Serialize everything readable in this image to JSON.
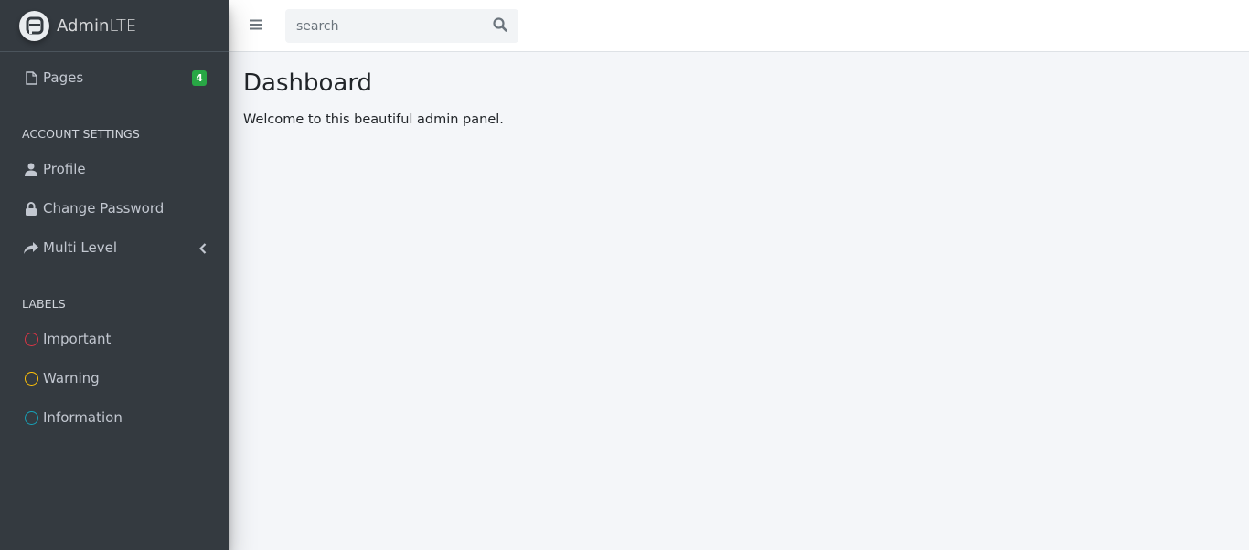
{
  "brand": {
    "name_bold": "Admin",
    "name_light": "LTE"
  },
  "sidebar": {
    "pages": {
      "label": "Pages",
      "badge": "4",
      "icon": "file-icon"
    },
    "account_header": "ACCOUNT SETTINGS",
    "account_items": [
      {
        "label": "Profile",
        "icon": "user-icon"
      },
      {
        "label": "Change Password",
        "icon": "lock-icon"
      },
      {
        "label": "Multi Level",
        "icon": "share-icon"
      }
    ],
    "labels_header": "LABELS",
    "label_items": [
      {
        "label": "Important",
        "color": "#dc3545"
      },
      {
        "label": "Warning",
        "color": "#ffc107"
      },
      {
        "label": "Information",
        "color": "#17a2b8"
      }
    ]
  },
  "topbar": {
    "search_placeholder": "search"
  },
  "main": {
    "title": "Dashboard",
    "text": "Welcome to this beautiful admin panel."
  },
  "colors": {
    "sidebar_bg": "#343a40",
    "content_bg": "#f4f6f9",
    "badge": "#28a745"
  }
}
